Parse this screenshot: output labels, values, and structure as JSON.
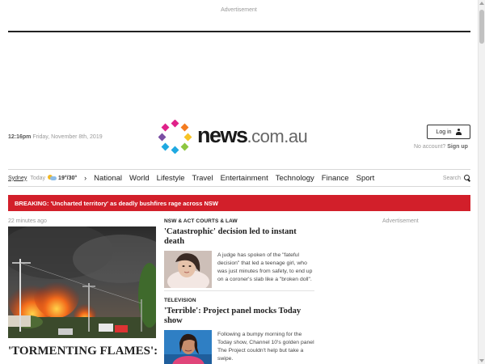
{
  "ads": {
    "top_label": "Advertisement",
    "right_label": "Advertisement"
  },
  "header": {
    "time": "12:16pm",
    "date": "Friday, November 8th, 2019",
    "logo": {
      "main": "news",
      "domain": ".com.au"
    },
    "login_label": "Log in",
    "no_account": "No account?",
    "signup": "Sign up"
  },
  "nav": {
    "city": "Sydney",
    "today": "Today",
    "temps": "19°/30°",
    "items": [
      "National",
      "World",
      "Lifestyle",
      "Travel",
      "Entertainment",
      "Technology",
      "Finance",
      "Sport"
    ],
    "search_label": "Search"
  },
  "breaking": {
    "label": "BREAKING:",
    "text": "'Uncharted territory' as deadly bushfires rage across NSW"
  },
  "lead": {
    "time": "22 minutes ago",
    "headline": "'TORMENTING FLAMES':"
  },
  "stories": [
    {
      "category": "NSW & ACT COURTS & LAW",
      "headline": "'Catastrophic' decision led to instant death",
      "summary": "A judge has spoken of the \"fateful decision\" that led a teenage girl, who was just minutes from safety, to end up on a coroner's slab like a \"broken doll\"."
    },
    {
      "category": "TELEVISION",
      "headline": "'Terrible': Project panel mocks Today show",
      "summary": "Following a bumpy morning for the Today show, Channel 10's golden panel The Project couldn't help but take a swipe."
    }
  ],
  "colors": {
    "breaking_bg": "#d21f2a",
    "logo_dots": [
      "#e0218a",
      "#f47c20",
      "#8dc63f",
      "#1fa9e1",
      "#7a4fa3",
      "#f7c325"
    ]
  },
  "icons": [
    "user-icon",
    "weather-icon",
    "chevron-right-icon",
    "search-icon"
  ]
}
